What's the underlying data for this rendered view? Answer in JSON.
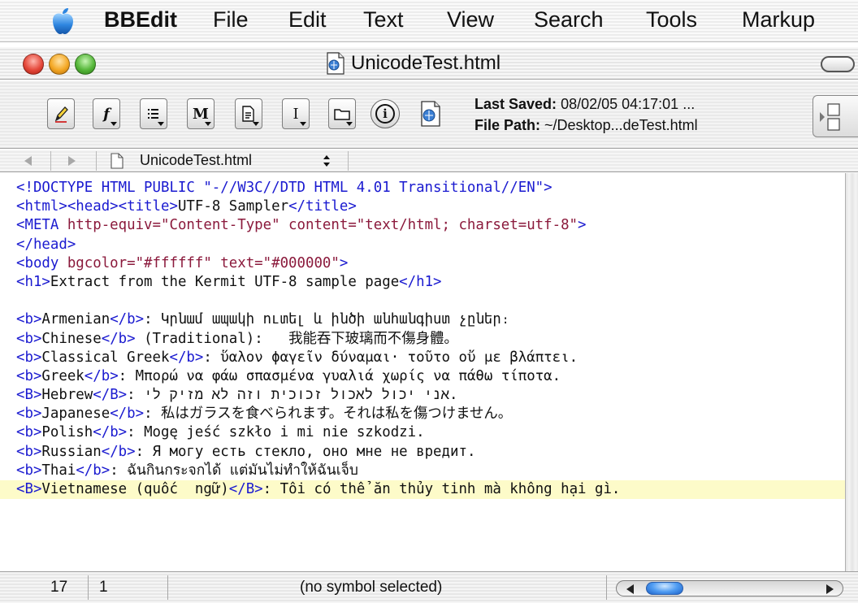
{
  "menubar": {
    "apple_icon": "apple-icon",
    "app_name": "BBEdit",
    "items": [
      "File",
      "Edit",
      "Text",
      "View",
      "Search",
      "Tools",
      "Markup"
    ]
  },
  "window": {
    "title": "UnicodeTest.html",
    "title_icon": "html-document-icon"
  },
  "toolbar": {
    "buttons": [
      {
        "icon": "pencil-icon",
        "glyph": "✎"
      },
      {
        "icon": "function-popup-icon",
        "glyph": "f"
      },
      {
        "icon": "list-popup-icon",
        "glyph": "≡"
      },
      {
        "icon": "markers-popup-icon",
        "glyph": "M"
      },
      {
        "icon": "document-popup-icon",
        "glyph": "B"
      },
      {
        "icon": "insert-popup-icon",
        "glyph": "I"
      },
      {
        "icon": "folder-popup-icon",
        "glyph": "▭"
      },
      {
        "icon": "info-icon",
        "glyph": "i"
      }
    ],
    "saved_label": "Last Saved:",
    "saved_value": "08/02/05 04:17:01 ...",
    "path_label": "File Path:",
    "path_value": "~/Desktop...deTest.html"
  },
  "navbar": {
    "file_name": "UnicodeTest.html",
    "back_icon": "back-arrow-icon",
    "forward_icon": "forward-arrow-icon"
  },
  "editor": {
    "lines": [
      [
        [
          "tag",
          "<!DOCTYPE HTML PUBLIC \"-//W3C//DTD HTML 4.01 Transitional//EN\">"
        ]
      ],
      [
        [
          "tag",
          "<html><head><title>"
        ],
        [
          "txt",
          "UTF-8 Sampler"
        ],
        [
          "tag",
          "</title>"
        ]
      ],
      [
        [
          "tag",
          "<META "
        ],
        [
          "attr",
          "http-equiv=\"Content-Type\" content=\"text/html; charset=utf-8\""
        ],
        [
          "tag",
          ">"
        ]
      ],
      [
        [
          "tag",
          "</head>"
        ]
      ],
      [
        [
          "tag",
          "<body "
        ],
        [
          "attr",
          "bgcolor=\"#ffffff\" text=\"#000000\""
        ],
        [
          "tag",
          ">"
        ]
      ],
      [
        [
          "tag",
          "<h1>"
        ],
        [
          "txt",
          "Extract from the Kermit UTF-8 sample page"
        ],
        [
          "tag",
          "</h1>"
        ]
      ],
      [],
      [
        [
          "tag",
          "<b>"
        ],
        [
          "txt",
          "Armenian"
        ],
        [
          "tag",
          "</b>"
        ],
        [
          "txt",
          ": Կրնամ ապակի ուտել և ինծի անհանգիստ չըներ։"
        ]
      ],
      [
        [
          "tag",
          "<b>"
        ],
        [
          "txt",
          "Chinese"
        ],
        [
          "tag",
          "</b>"
        ],
        [
          "txt",
          " (Traditional):   我能吞下玻璃而不傷身體。"
        ]
      ],
      [
        [
          "tag",
          "<b>"
        ],
        [
          "txt",
          "Classical Greek"
        ],
        [
          "tag",
          "</b>"
        ],
        [
          "txt",
          ": ὕαλον ϕαγεῖν δύναμαι· τοῦτο οὔ με βλάπτει."
        ]
      ],
      [
        [
          "tag",
          "<b>"
        ],
        [
          "txt",
          "Greek"
        ],
        [
          "tag",
          "</b>"
        ],
        [
          "txt",
          ": Μπορώ να φάω σπασμένα γυαλιά χωρίς να πάθω τίποτα."
        ]
      ],
      [
        [
          "tag",
          "<B>"
        ],
        [
          "txt",
          "Hebrew"
        ],
        [
          "tag",
          "</B>"
        ],
        [
          "txt",
          ": אני יכול לאכול זכוכית וזה לא מזיק לי."
        ]
      ],
      [
        [
          "tag",
          "<b>"
        ],
        [
          "txt",
          "Japanese"
        ],
        [
          "tag",
          "</b>"
        ],
        [
          "txt",
          ": 私はガラスを食べられます。それは私を傷つけません。"
        ]
      ],
      [
        [
          "tag",
          "<b>"
        ],
        [
          "txt",
          "Polish"
        ],
        [
          "tag",
          "</b>"
        ],
        [
          "txt",
          ": Mogę jeść szkło i mi nie szkodzi."
        ]
      ],
      [
        [
          "tag",
          "<b>"
        ],
        [
          "txt",
          "Russian"
        ],
        [
          "tag",
          "</b>"
        ],
        [
          "txt",
          ": Я могу есть стекло, оно мне не вредит."
        ]
      ],
      [
        [
          "tag",
          "<b>"
        ],
        [
          "txt",
          "Thai"
        ],
        [
          "tag",
          "</b>"
        ],
        [
          "txt",
          ": ฉันกินกระจกได้ แต่มันไม่ทำให้ฉันเจ็บ"
        ]
      ],
      [
        [
          "tag",
          "<B>"
        ],
        [
          "txt",
          "Vietnamese (quốc  ngữ)"
        ],
        [
          "tag",
          "</B>"
        ],
        [
          "txt",
          ": Tôi có thể ăn thủy tinh mà không hại gì."
        ]
      ]
    ],
    "current_line_index": 16,
    "current_line_color": "#fdfbc9"
  },
  "statusbar": {
    "line": "17",
    "column": "1",
    "symbol": "(no symbol selected)"
  },
  "colors": {
    "tag": "#1a1ad0",
    "attribute": "#8b1a3c",
    "text": "#111111"
  }
}
